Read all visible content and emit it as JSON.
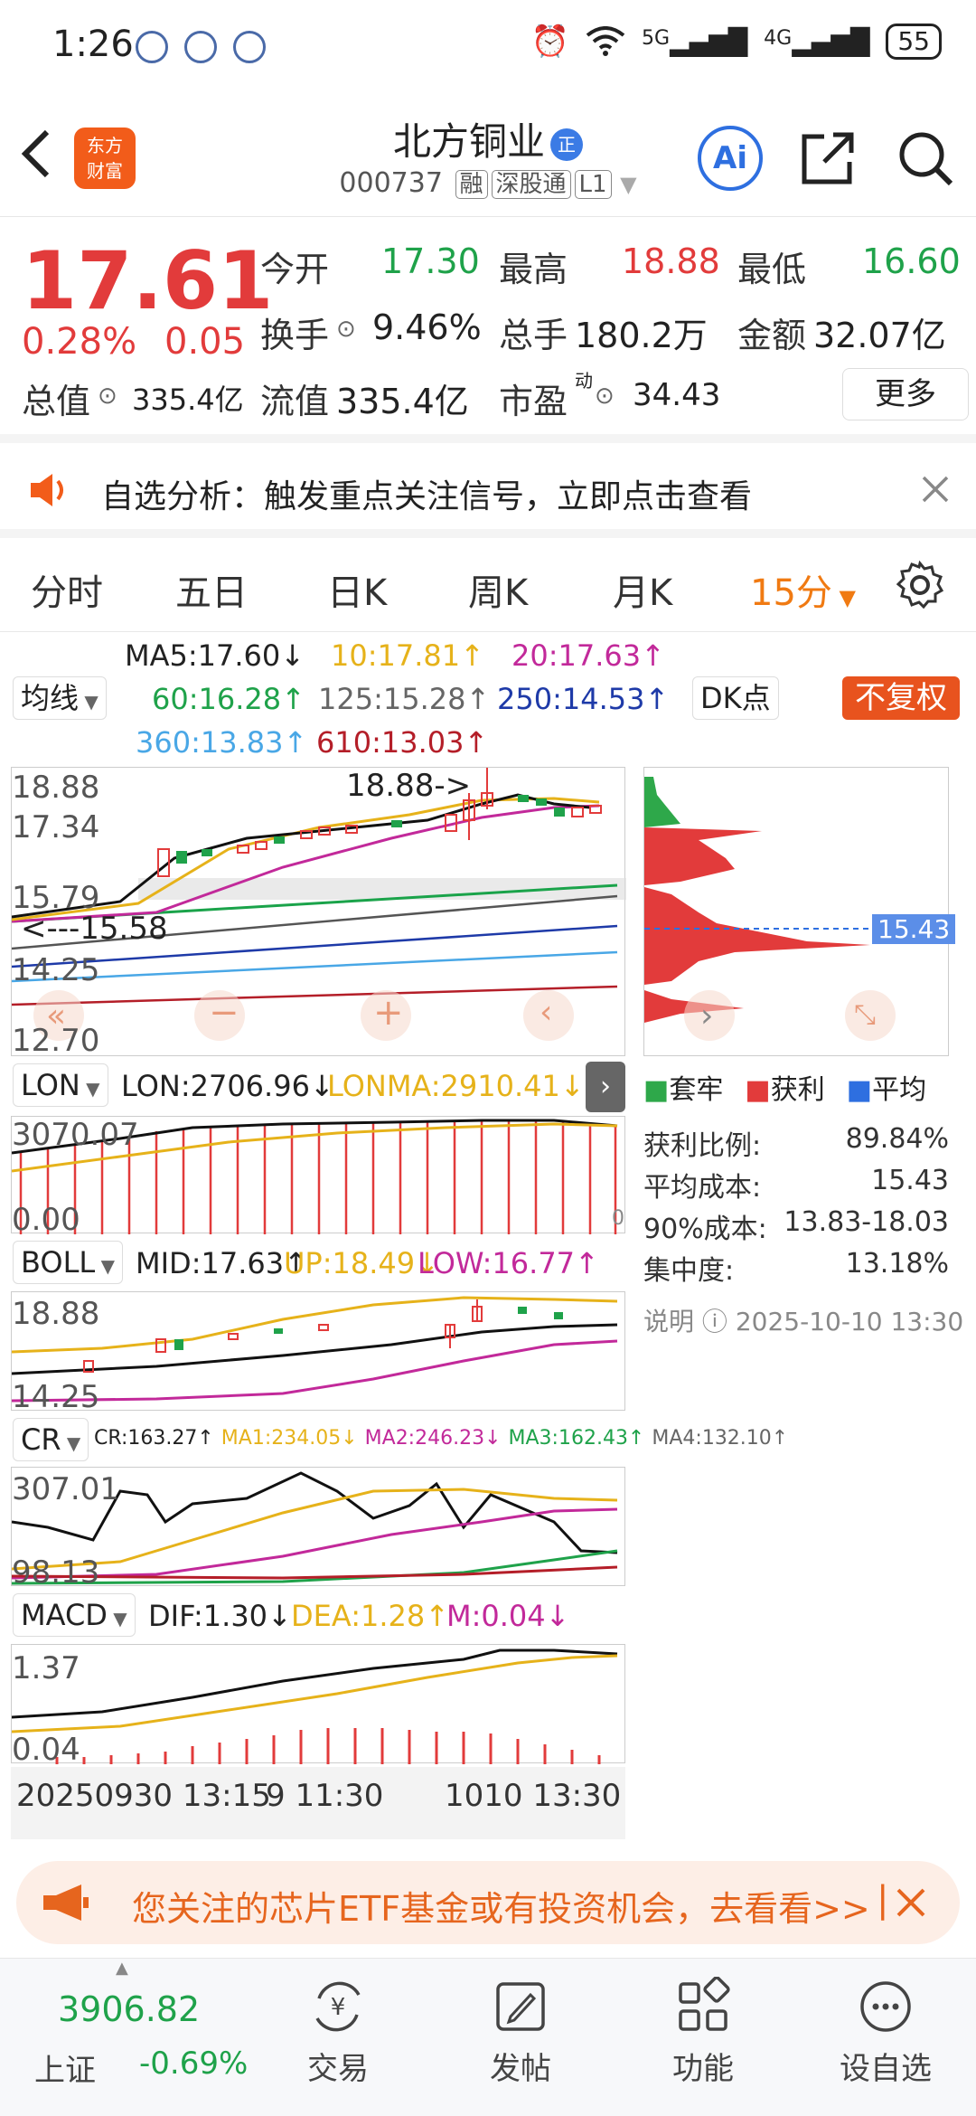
{
  "status": {
    "time": "1:26",
    "net1": "5G",
    "net2": "4G",
    "battery": "55"
  },
  "header": {
    "back_icon": "chevron-left-icon",
    "logo_top": "东方",
    "logo_bottom": "财富",
    "title": "北方铜业",
    "title_tag": "正",
    "code": "000737",
    "badges": [
      "融",
      "深股通",
      "L1"
    ],
    "ai_label": "Ai"
  },
  "quote": {
    "price": "17.61",
    "pct": "0.28%",
    "change": "0.05",
    "open_label": "今开",
    "open": "17.30",
    "high_label": "最高",
    "high": "18.88",
    "low_label": "最低",
    "low": "16.60",
    "turnover_label": "换手",
    "turnover": "9.46%",
    "volume_label": "总手",
    "volume": "180.2万",
    "amount_label": "金额",
    "amount": "32.07亿",
    "mcap_label": "总值",
    "mcap": "335.4亿",
    "float_label": "流值",
    "float": "335.4亿",
    "pe_label": "市盈",
    "pe_sup": "动",
    "pe": "34.43",
    "more_label": "更多"
  },
  "notice": {
    "text": "自选分析：触发重点关注信号，立即点击查看"
  },
  "tabs": [
    {
      "label": "分时",
      "active": false
    },
    {
      "label": "五日",
      "active": false
    },
    {
      "label": "日K",
      "active": false
    },
    {
      "label": "周K",
      "active": false
    },
    {
      "label": "月K",
      "active": false
    },
    {
      "label": "15分",
      "active": true
    }
  ],
  "ma": {
    "selector": "均线",
    "ma5": "MA5:17.60↓",
    "ma10": "10:17.81↑",
    "ma20": "20:17.63↑",
    "ma60": "60:16.28↑",
    "ma125": "125:15.28↑",
    "ma250": "250:14.53↑",
    "ma360": "360:13.83↑",
    "ma610": "610:13.03↑",
    "dk_label": "DK点",
    "adjust_label": "不复权"
  },
  "kline": {
    "y_labels": [
      "18.88",
      "17.34",
      "15.79",
      "14.25",
      "12.70"
    ],
    "peak_annot": "18.88->",
    "low_annot": "<---15.58"
  },
  "chip": {
    "cost_tag": "15.43",
    "legend": [
      "套牢",
      "获利",
      "平均"
    ],
    "rows": [
      {
        "label": "获利比例:",
        "value": "89.84%"
      },
      {
        "label": "平均成本:",
        "value": "15.43"
      },
      {
        "label": "90%成本:",
        "value": "13.83-18.03"
      },
      {
        "label": "集中度:",
        "value": "13.18%"
      }
    ],
    "note_label": "说明",
    "note_time": "2025-10-10 13:30"
  },
  "lon": {
    "selector": "LON",
    "val": "LON:2706.96↓",
    "ma": "LONMA:2910.41↓",
    "y_top": "3070.07",
    "y_bot": "0.00",
    "y_bot_right": "0"
  },
  "boll": {
    "selector": "BOLL",
    "mid": "MID:17.63↑",
    "up": "UP:18.49↓",
    "low": "LOW:16.77↑",
    "y_top": "18.88",
    "y_bot": "14.25"
  },
  "cr": {
    "selector": "CR",
    "cr": "CR:163.27↑",
    "ma1": "MA1:234.05↓",
    "ma2": "MA2:246.23↓",
    "ma3": "MA3:162.43↑",
    "ma4": "MA4:132.10↑",
    "y_top": "307.01",
    "y_bot": "98.13"
  },
  "macd": {
    "selector": "MACD",
    "dif": "DIF:1.30↓",
    "dea": "DEA:1.28↑",
    "m": "M:0.04↓",
    "y_top": "1.37",
    "y_bot": "0.04"
  },
  "time_axis": {
    "left": "20250930 13:15",
    "mid": "9  11:30",
    "right": "1010 13:30"
  },
  "ad": {
    "text": "您关注的芯片ETF基金或有投资机会，去看看>>"
  },
  "bottom": {
    "index_value": "3906.82",
    "index_name": "上证",
    "index_change": "-0.69%",
    "nav": [
      {
        "label": "交易",
        "icon": "yen-cycle-icon"
      },
      {
        "label": "发帖",
        "icon": "edit-icon"
      },
      {
        "label": "功能",
        "icon": "grid-icon"
      },
      {
        "label": "设自选",
        "icon": "more-circle-icon"
      }
    ]
  }
}
